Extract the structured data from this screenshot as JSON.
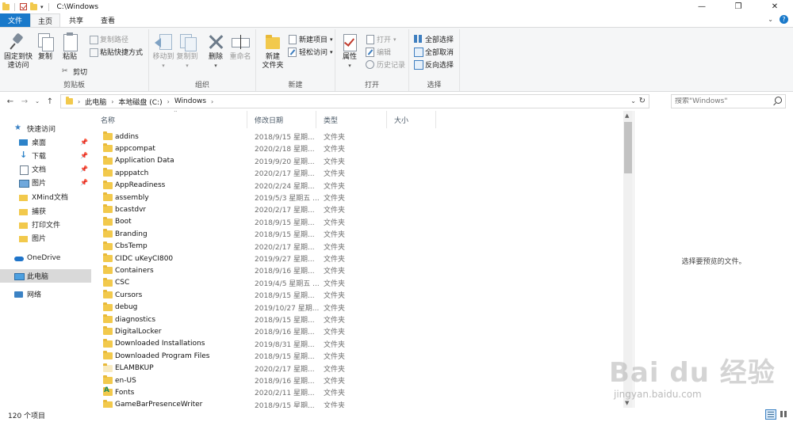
{
  "window": {
    "title": "C:\\Windows",
    "minimize": "—",
    "restore": "❐",
    "close": "✕"
  },
  "tabs": {
    "file": "文件",
    "home": "主页",
    "share": "共享",
    "view": "查看"
  },
  "ribbon": {
    "clipboard": {
      "label": "剪贴板",
      "pin": "固定到快\n速访问",
      "copy": "复制",
      "paste": "粘贴",
      "copy_path": "复制路径",
      "paste_shortcut": "粘贴快捷方式",
      "cut": "剪切"
    },
    "organize": {
      "label": "组织",
      "move_to": "移动到",
      "copy_to": "复制到",
      "delete": "删除",
      "rename": "重命名"
    },
    "new": {
      "label": "新建",
      "new_folder": "新建\n文件夹",
      "new_item": "新建项目",
      "easy_access": "轻松访问"
    },
    "open": {
      "label": "打开",
      "properties": "属性",
      "open": "打开",
      "edit": "编辑",
      "history": "历史记录"
    },
    "select": {
      "label": "选择",
      "select_all": "全部选择",
      "select_none": "全部取消",
      "invert": "反向选择"
    }
  },
  "address": {
    "crumbs": [
      "此电脑",
      "本地磁盘 (C:)",
      "Windows"
    ]
  },
  "search": {
    "placeholder": "搜索\"Windows\""
  },
  "nav": {
    "quick_access": "快速访问",
    "items": [
      "桌面",
      "下载",
      "文档",
      "图片",
      "XMind文档",
      "捕获",
      "打印文件",
      "图片"
    ],
    "onedrive": "OneDrive",
    "this_pc": "此电脑",
    "network": "网络"
  },
  "columns": {
    "name": "名称",
    "date": "修改日期",
    "type": "类型",
    "size": "大小"
  },
  "files": [
    {
      "name": "addins",
      "date": "2018/9/15 星期...",
      "type": "文件夹"
    },
    {
      "name": "appcompat",
      "date": "2020/2/18 星期...",
      "type": "文件夹"
    },
    {
      "name": "Application Data",
      "date": "2019/9/20 星期...",
      "type": "文件夹"
    },
    {
      "name": "apppatch",
      "date": "2020/2/17 星期...",
      "type": "文件夹"
    },
    {
      "name": "AppReadiness",
      "date": "2020/2/24 星期...",
      "type": "文件夹"
    },
    {
      "name": "assembly",
      "date": "2019/5/3 星期五 ...",
      "type": "文件夹"
    },
    {
      "name": "bcastdvr",
      "date": "2020/2/17 星期...",
      "type": "文件夹"
    },
    {
      "name": "Boot",
      "date": "2018/9/15 星期...",
      "type": "文件夹"
    },
    {
      "name": "Branding",
      "date": "2018/9/15 星期...",
      "type": "文件夹"
    },
    {
      "name": "CbsTemp",
      "date": "2020/2/17 星期...",
      "type": "文件夹"
    },
    {
      "name": "CIDC uKeyCI800",
      "date": "2019/9/27 星期...",
      "type": "文件夹"
    },
    {
      "name": "Containers",
      "date": "2018/9/16 星期...",
      "type": "文件夹"
    },
    {
      "name": "CSC",
      "date": "2019/4/5 星期五 ...",
      "type": "文件夹"
    },
    {
      "name": "Cursors",
      "date": "2018/9/15 星期...",
      "type": "文件夹"
    },
    {
      "name": "debug",
      "date": "2019/10/27 星期...",
      "type": "文件夹"
    },
    {
      "name": "diagnostics",
      "date": "2018/9/15 星期...",
      "type": "文件夹"
    },
    {
      "name": "DigitalLocker",
      "date": "2018/9/16 星期...",
      "type": "文件夹"
    },
    {
      "name": "Downloaded Installations",
      "date": "2019/8/31 星期...",
      "type": "文件夹"
    },
    {
      "name": "Downloaded Program Files",
      "date": "2018/9/15 星期...",
      "type": "文件夹"
    },
    {
      "name": "ELAMBKUP",
      "date": "2020/2/17 星期...",
      "type": "文件夹"
    },
    {
      "name": "en-US",
      "date": "2018/9/16 星期...",
      "type": "文件夹"
    },
    {
      "name": "Fonts",
      "date": "2020/2/11 星期...",
      "type": "文件夹"
    },
    {
      "name": "GameBarPresenceWriter",
      "date": "2018/9/15 星期...",
      "type": "文件夹"
    }
  ],
  "preview": {
    "message": "选择要预览的文件。"
  },
  "status": {
    "count": "120 个项目"
  },
  "watermark": {
    "main": "Bai du 经验",
    "sub": "jingyan.baidu.com"
  }
}
